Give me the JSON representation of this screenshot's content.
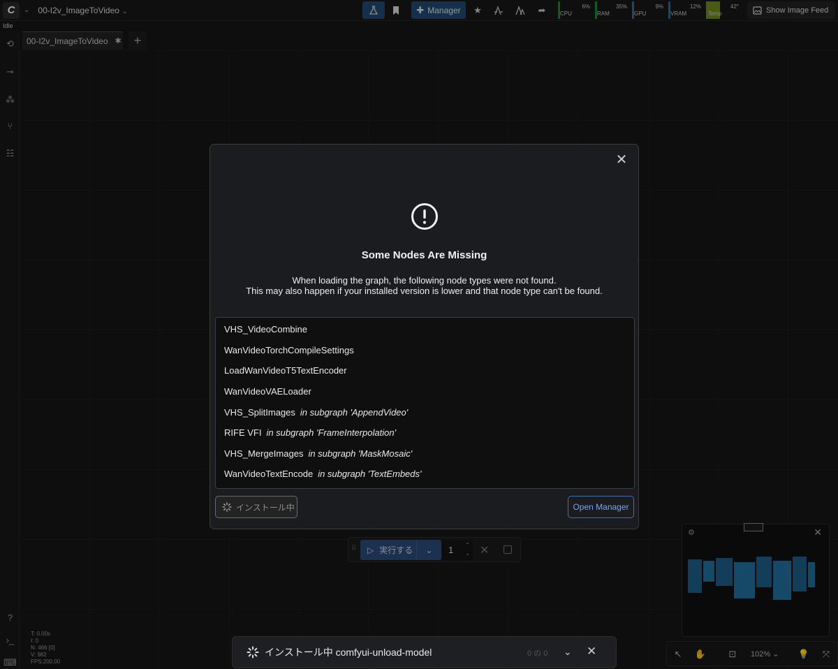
{
  "app": {
    "workflow_name": "00-I2v_ImageToVideo",
    "status": "Idle",
    "manager_label": "Manager",
    "show_feed_label": "Show Image Feed"
  },
  "monitors": [
    {
      "label": "CPU",
      "value": "6%",
      "color": "#1f8a2e"
    },
    {
      "label": "RAM",
      "value": "35%",
      "color": "#1f8a2e"
    },
    {
      "label": "GPU",
      "value": "9%",
      "color": "#2b6cb0"
    },
    {
      "label": "VRAM",
      "value": "12%",
      "color": "#2b6cb0"
    },
    {
      "label": "Temp",
      "value": "42°",
      "color": "#6f8a1f"
    }
  ],
  "tabs": [
    {
      "label": "00-I2v_ImageToVideo"
    }
  ],
  "dialog": {
    "title": "Some Nodes Are Missing",
    "message_line1": "When loading the graph, the following node types were not found.",
    "message_line2": "This may also happen if your installed version is lower and that node type can't be found.",
    "nodes": [
      {
        "name": "VHS_VideoCombine",
        "subgraph": ""
      },
      {
        "name": "WanVideoTorchCompileSettings",
        "subgraph": ""
      },
      {
        "name": "LoadWanVideoT5TextEncoder",
        "subgraph": ""
      },
      {
        "name": "WanVideoVAELoader",
        "subgraph": ""
      },
      {
        "name": "VHS_SplitImages",
        "subgraph": "in subgraph 'AppendVideo'"
      },
      {
        "name": "RIFE VFI",
        "subgraph": "in subgraph 'FrameInterpolation'"
      },
      {
        "name": "VHS_MergeImages",
        "subgraph": "in subgraph 'MaskMosaic'"
      },
      {
        "name": "WanVideoTextEncode",
        "subgraph": "in subgraph 'TextEmbeds'"
      }
    ],
    "install_label": "インストール中",
    "open_manager_label": "Open Manager"
  },
  "run": {
    "label": "実行する",
    "count": "1"
  },
  "zoom": "102%",
  "stats": [
    "T: 0.00s",
    "I: 0",
    "N: 466 [0]",
    "V: 982",
    "FPS:200.00"
  ],
  "toast": {
    "text": "インストール中 comfyui-unload-model",
    "count": "0 の 0"
  }
}
